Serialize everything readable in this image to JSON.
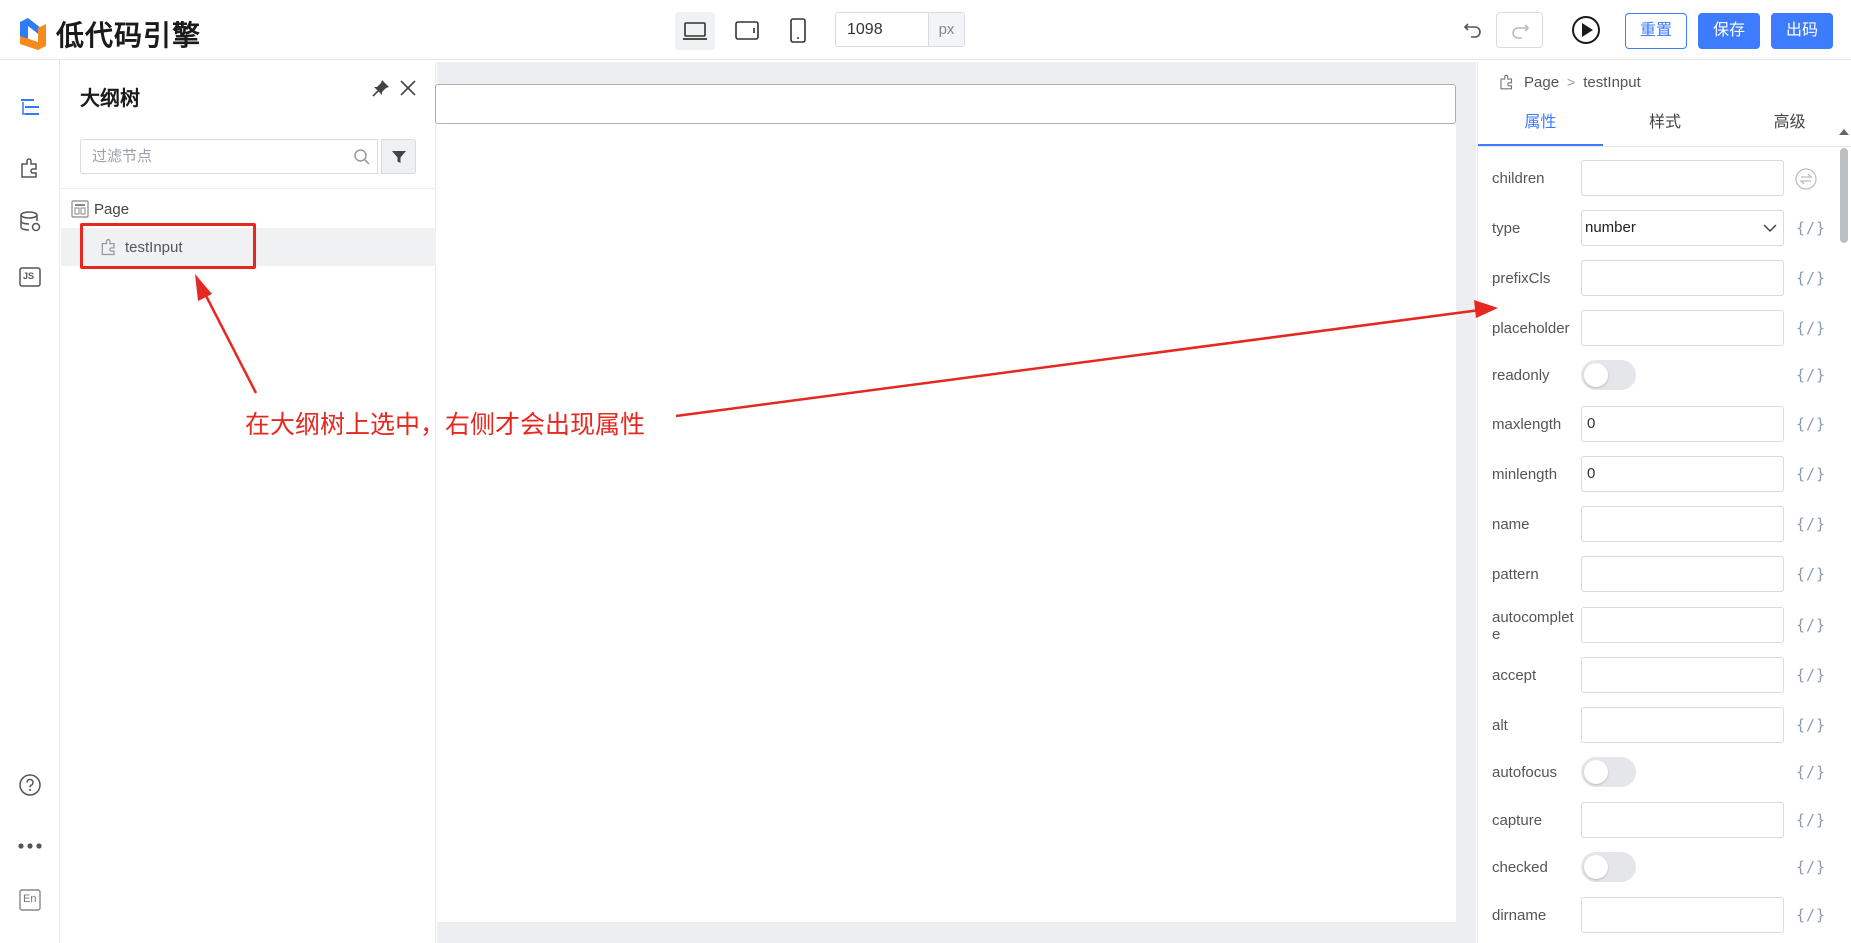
{
  "app": {
    "logo_text": "低代码引擎"
  },
  "toolbar": {
    "devices": [
      {
        "name": "desktop",
        "active": true
      },
      {
        "name": "tablet",
        "active": false
      },
      {
        "name": "phone",
        "active": false
      }
    ],
    "canvas_width": "1098",
    "width_unit": "px",
    "reset_label": "重置",
    "save_label": "保存",
    "code_label": "出码",
    "colors": {
      "primary": "#3d7bff"
    }
  },
  "rail": {
    "icons": [
      "outline-icon",
      "component-icon",
      "datasource-icon",
      "js-icon",
      "help-icon",
      "more-icon",
      "language-en-icon"
    ],
    "lang_label": "En",
    "js_label": "JS"
  },
  "outline": {
    "title": "大纲树",
    "filter_placeholder": "过滤节点",
    "tree": {
      "page_label": "Page",
      "child_label": "testInput"
    }
  },
  "props": {
    "breadcrumb": {
      "root": "Page",
      "current": "testInput"
    },
    "tabs": [
      {
        "label": "属性",
        "active": true
      },
      {
        "label": "样式",
        "active": false
      },
      {
        "label": "高级",
        "active": false
      }
    ],
    "expr_label": "{/}",
    "rows": [
      {
        "label": "children",
        "kind": "input",
        "value": ""
      },
      {
        "label": "type",
        "kind": "select",
        "value": "number"
      },
      {
        "label": "prefixCls",
        "kind": "input",
        "value": ""
      },
      {
        "label": "placeholder",
        "kind": "input",
        "value": ""
      },
      {
        "label": "readonly",
        "kind": "toggle",
        "value": "off"
      },
      {
        "label": "maxlength",
        "kind": "input",
        "value": "0"
      },
      {
        "label": "minlength",
        "kind": "input",
        "value": "0"
      },
      {
        "label": "name",
        "kind": "input",
        "value": ""
      },
      {
        "label": "pattern",
        "kind": "input",
        "value": ""
      },
      {
        "label": "autocomplet",
        "label2": "e",
        "kind": "input",
        "value": ""
      },
      {
        "label": "accept",
        "kind": "input",
        "value": ""
      },
      {
        "label": "alt",
        "kind": "input",
        "value": ""
      },
      {
        "label": "autofocus",
        "kind": "toggle",
        "value": "off"
      },
      {
        "label": "capture",
        "kind": "input",
        "value": ""
      },
      {
        "label": "checked",
        "kind": "toggle",
        "value": "off"
      },
      {
        "label": "dirname",
        "kind": "input",
        "value": ""
      }
    ]
  },
  "annotation": {
    "text": "在大纲树上选中，右侧才会出现属性",
    "color": "#e52820"
  }
}
